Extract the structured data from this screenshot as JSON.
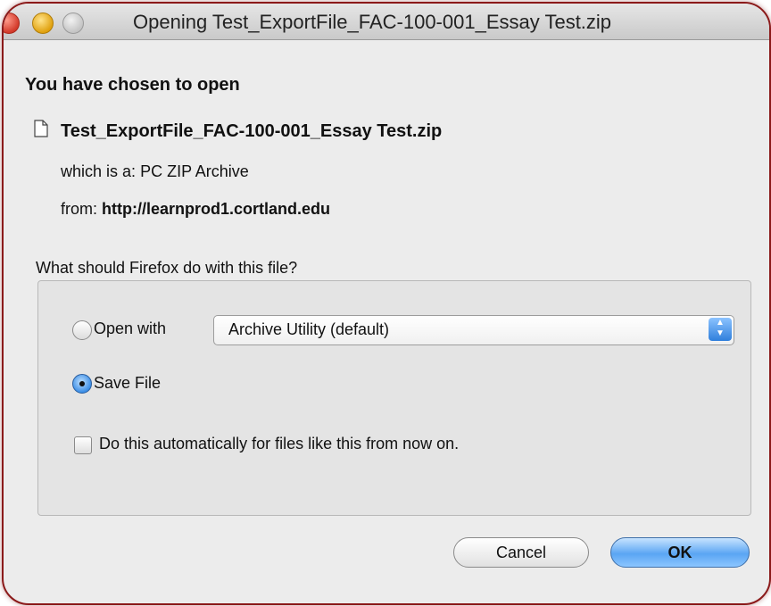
{
  "window": {
    "title": "Opening Test_ExportFile_FAC-100-001_Essay Test.zip"
  },
  "dialog": {
    "heading": "You have chosen to open",
    "file_name": "Test_ExportFile_FAC-100-001_Essay Test.zip",
    "which_label": "which is a:",
    "which_value": "PC ZIP Archive",
    "from_label": "from:",
    "from_value": "http://learnprod1.cortland.edu",
    "question": "What should Firefox do with this file?",
    "open_with_label": "Open with",
    "open_with_app": "Archive Utility (default)",
    "save_file_label": "Save File",
    "selected_option": "Save File",
    "auto_label": "Do this automatically for files like this from now on.",
    "auto_checked": false,
    "cancel_label": "Cancel",
    "ok_label": "OK"
  },
  "icons": {
    "window_controls": [
      "close-icon",
      "minimize-icon",
      "zoom-icon"
    ],
    "file": "document-icon",
    "select": "up-down-arrows-icon"
  },
  "colors": {
    "frame_border": "#8b1a1a",
    "accent": "#3b8ee6",
    "dialog_bg": "#ececec"
  }
}
